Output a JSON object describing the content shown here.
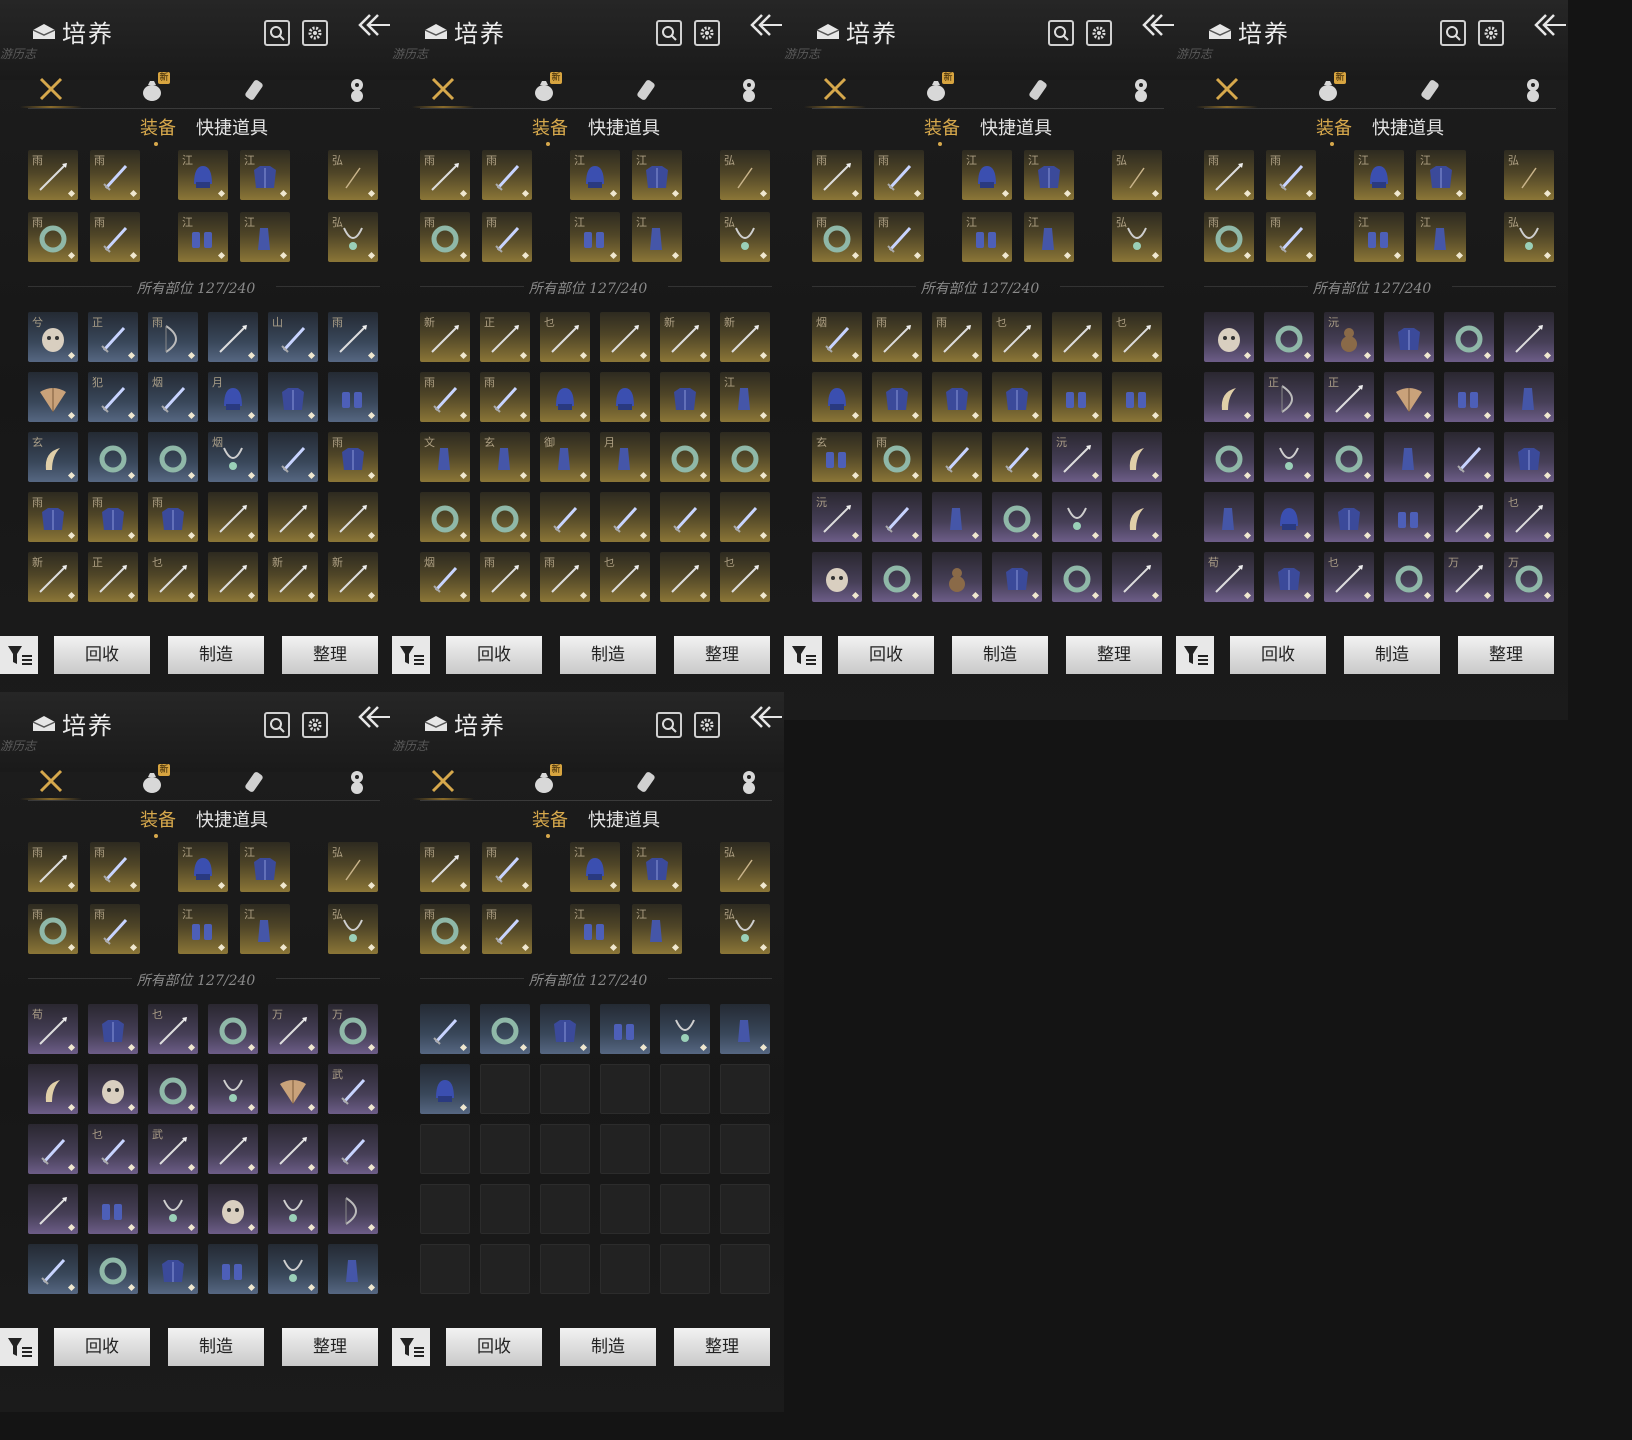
{
  "title": "培养",
  "subtitle": "游历志",
  "tab_new_badge": "新",
  "subtabs": {
    "equipment": "装备",
    "quick_items": "快捷道具"
  },
  "count_label": "所有部位 127/240",
  "footer": {
    "recycle": "回收",
    "craft": "制造",
    "organize": "整理"
  },
  "colors": {
    "accent": "#d6a84c",
    "gold": "#8b7637",
    "blue": "#566782",
    "purple": "#6d5d88"
  },
  "equipped": [
    {
      "ch": "雨",
      "icon": "spear-icon"
    },
    {
      "ch": "雨",
      "icon": "blade-icon"
    },
    {
      "ch": "江",
      "icon": "helmet-icon"
    },
    {
      "ch": "江",
      "icon": "armor-icon"
    },
    {
      "ch": "弘",
      "icon": "talisman-icon"
    },
    {
      "ch": "雨",
      "icon": "ring-icon"
    },
    {
      "ch": "雨",
      "icon": "blade-icon"
    },
    {
      "ch": "江",
      "icon": "gauntlet-icon"
    },
    {
      "ch": "江",
      "icon": "greave-icon"
    },
    {
      "ch": "弘",
      "icon": "necklace-icon"
    }
  ],
  "panels": [
    {
      "items": [
        {
          "r": "blue",
          "ch": "兮",
          "icon": "mask-icon"
        },
        {
          "r": "blue",
          "ch": "正",
          "icon": "blade-icon"
        },
        {
          "r": "blue",
          "ch": "雨",
          "icon": "bow-icon"
        },
        {
          "r": "blue",
          "ch": "",
          "icon": "spear-icon"
        },
        {
          "r": "blue",
          "ch": "山",
          "icon": "blade-icon"
        },
        {
          "r": "blue",
          "ch": "雨",
          "icon": "spear-icon"
        },
        {
          "r": "blue",
          "ch": "",
          "icon": "fan-icon"
        },
        {
          "r": "blue",
          "ch": "犯",
          "icon": "blade-icon"
        },
        {
          "r": "blue",
          "ch": "烟",
          "icon": "blade-icon"
        },
        {
          "r": "blue",
          "ch": "月",
          "icon": "helmet-icon"
        },
        {
          "r": "blue",
          "ch": "",
          "icon": "armor-icon"
        },
        {
          "r": "blue",
          "ch": "",
          "icon": "gauntlet-icon"
        },
        {
          "r": "blue",
          "ch": "玄",
          "icon": "horn-icon"
        },
        {
          "r": "blue",
          "ch": "",
          "icon": "ring-icon"
        },
        {
          "r": "blue",
          "ch": "",
          "icon": "ring-icon"
        },
        {
          "r": "blue",
          "ch": "烟",
          "icon": "necklace-icon"
        },
        {
          "r": "blue",
          "ch": "",
          "icon": "blade-icon"
        },
        {
          "r": "gold",
          "ch": "雨",
          "icon": "armor-icon"
        },
        {
          "r": "gold",
          "ch": "雨",
          "icon": "armor-icon"
        },
        {
          "r": "gold",
          "ch": "雨",
          "icon": "armor-icon"
        },
        {
          "r": "gold",
          "ch": "雨",
          "icon": "armor-icon"
        },
        {
          "r": "gold",
          "ch": "",
          "icon": "spear-icon"
        },
        {
          "r": "gold",
          "ch": "",
          "icon": "spear-icon"
        },
        {
          "r": "gold",
          "ch": "",
          "icon": "spear-icon"
        },
        {
          "r": "gold",
          "ch": "新",
          "icon": "spear-icon"
        },
        {
          "r": "gold",
          "ch": "正",
          "icon": "spear-icon"
        },
        {
          "r": "gold",
          "ch": "乜",
          "icon": "spear-icon"
        },
        {
          "r": "gold",
          "ch": "",
          "icon": "spear-icon"
        },
        {
          "r": "gold",
          "ch": "新",
          "icon": "spear-icon"
        },
        {
          "r": "gold",
          "ch": "新",
          "icon": "spear-icon"
        }
      ]
    },
    {
      "items": [
        {
          "r": "gold",
          "ch": "新",
          "icon": "spear-icon"
        },
        {
          "r": "gold",
          "ch": "正",
          "icon": "spear-icon"
        },
        {
          "r": "gold",
          "ch": "乜",
          "icon": "spear-icon"
        },
        {
          "r": "gold",
          "ch": "",
          "icon": "spear-icon"
        },
        {
          "r": "gold",
          "ch": "新",
          "icon": "spear-icon"
        },
        {
          "r": "gold",
          "ch": "新",
          "icon": "spear-icon"
        },
        {
          "r": "gold",
          "ch": "雨",
          "icon": "blade-icon"
        },
        {
          "r": "gold",
          "ch": "雨",
          "icon": "blade-icon"
        },
        {
          "r": "gold",
          "ch": "",
          "icon": "helmet-icon"
        },
        {
          "r": "gold",
          "ch": "",
          "icon": "helmet-icon"
        },
        {
          "r": "gold",
          "ch": "",
          "icon": "armor-icon"
        },
        {
          "r": "gold",
          "ch": "江",
          "icon": "greave-icon"
        },
        {
          "r": "gold",
          "ch": "文",
          "icon": "greave-icon"
        },
        {
          "r": "gold",
          "ch": "玄",
          "icon": "greave-icon"
        },
        {
          "r": "gold",
          "ch": "御",
          "icon": "greave-icon"
        },
        {
          "r": "gold",
          "ch": "月",
          "icon": "greave-icon"
        },
        {
          "r": "gold",
          "ch": "",
          "icon": "ring-icon"
        },
        {
          "r": "gold",
          "ch": "",
          "icon": "ring-icon"
        },
        {
          "r": "gold",
          "ch": "",
          "icon": "ring-icon"
        },
        {
          "r": "gold",
          "ch": "",
          "icon": "ring-icon"
        },
        {
          "r": "gold",
          "ch": "",
          "icon": "blade-icon"
        },
        {
          "r": "gold",
          "ch": "",
          "icon": "blade-icon"
        },
        {
          "r": "gold",
          "ch": "",
          "icon": "blade-icon"
        },
        {
          "r": "gold",
          "ch": "",
          "icon": "blade-icon"
        },
        {
          "r": "gold",
          "ch": "烟",
          "icon": "blade-icon"
        },
        {
          "r": "gold",
          "ch": "雨",
          "icon": "spear-icon"
        },
        {
          "r": "gold",
          "ch": "雨",
          "icon": "spear-icon"
        },
        {
          "r": "gold",
          "ch": "乜",
          "icon": "spear-icon"
        },
        {
          "r": "gold",
          "ch": "",
          "icon": "spear-icon"
        },
        {
          "r": "gold",
          "ch": "乜",
          "icon": "spear-icon"
        }
      ]
    },
    {
      "items": [
        {
          "r": "gold",
          "ch": "烟",
          "icon": "blade-icon"
        },
        {
          "r": "gold",
          "ch": "雨",
          "icon": "spear-icon"
        },
        {
          "r": "gold",
          "ch": "雨",
          "icon": "spear-icon"
        },
        {
          "r": "gold",
          "ch": "乜",
          "icon": "spear-icon"
        },
        {
          "r": "gold",
          "ch": "",
          "icon": "spear-icon"
        },
        {
          "r": "gold",
          "ch": "乜",
          "icon": "spear-icon"
        },
        {
          "r": "gold",
          "ch": "",
          "icon": "helmet-icon"
        },
        {
          "r": "gold",
          "ch": "",
          "icon": "armor-icon"
        },
        {
          "r": "gold",
          "ch": "",
          "icon": "armor-icon"
        },
        {
          "r": "gold",
          "ch": "",
          "icon": "armor-icon"
        },
        {
          "r": "gold",
          "ch": "",
          "icon": "gauntlet-icon"
        },
        {
          "r": "gold",
          "ch": "",
          "icon": "gauntlet-icon"
        },
        {
          "r": "gold",
          "ch": "玄",
          "icon": "gauntlet-icon"
        },
        {
          "r": "gold",
          "ch": "雨",
          "icon": "ring-icon"
        },
        {
          "r": "gold",
          "ch": "",
          "icon": "blade-icon"
        },
        {
          "r": "gold",
          "ch": "",
          "icon": "blade-icon"
        },
        {
          "r": "purple",
          "ch": "沅",
          "icon": "spear-icon"
        },
        {
          "r": "purple",
          "ch": "",
          "icon": "horn-icon"
        },
        {
          "r": "purple",
          "ch": "沅",
          "icon": "spear-icon"
        },
        {
          "r": "purple",
          "ch": "",
          "icon": "blade-icon"
        },
        {
          "r": "purple",
          "ch": "",
          "icon": "greave-icon"
        },
        {
          "r": "purple",
          "ch": "",
          "icon": "ring-icon"
        },
        {
          "r": "purple",
          "ch": "",
          "icon": "necklace-icon"
        },
        {
          "r": "purple",
          "ch": "",
          "icon": "horn-icon"
        },
        {
          "r": "purple",
          "ch": "",
          "icon": "mask-icon"
        },
        {
          "r": "purple",
          "ch": "",
          "icon": "ring-icon"
        },
        {
          "r": "purple",
          "ch": "",
          "icon": "gourd-icon"
        },
        {
          "r": "purple",
          "ch": "",
          "icon": "armor-icon"
        },
        {
          "r": "purple",
          "ch": "",
          "icon": "ring-icon"
        },
        {
          "r": "purple",
          "ch": "",
          "icon": "spear-icon"
        }
      ]
    },
    {
      "items": [
        {
          "r": "purple",
          "ch": "",
          "icon": "mask-icon"
        },
        {
          "r": "purple",
          "ch": "",
          "icon": "ring-icon"
        },
        {
          "r": "purple",
          "ch": "沅",
          "icon": "gourd-icon"
        },
        {
          "r": "purple",
          "ch": "",
          "icon": "armor-icon"
        },
        {
          "r": "purple",
          "ch": "",
          "icon": "ring-icon"
        },
        {
          "r": "purple",
          "ch": "",
          "icon": "spear-icon"
        },
        {
          "r": "purple",
          "ch": "",
          "icon": "horn-icon"
        },
        {
          "r": "purple",
          "ch": "正",
          "icon": "bow-icon"
        },
        {
          "r": "purple",
          "ch": "正",
          "icon": "spear-icon"
        },
        {
          "r": "purple",
          "ch": "",
          "icon": "fan-icon"
        },
        {
          "r": "purple",
          "ch": "",
          "icon": "gauntlet-icon"
        },
        {
          "r": "purple",
          "ch": "",
          "icon": "greave-icon"
        },
        {
          "r": "purple",
          "ch": "",
          "icon": "ring-icon"
        },
        {
          "r": "purple",
          "ch": "",
          "icon": "necklace-icon"
        },
        {
          "r": "purple",
          "ch": "",
          "icon": "ring-icon"
        },
        {
          "r": "purple",
          "ch": "",
          "icon": "greave-icon"
        },
        {
          "r": "purple",
          "ch": "",
          "icon": "blade-icon"
        },
        {
          "r": "purple",
          "ch": "",
          "icon": "armor-icon"
        },
        {
          "r": "purple",
          "ch": "",
          "icon": "greave-icon"
        },
        {
          "r": "purple",
          "ch": "",
          "icon": "helmet-icon"
        },
        {
          "r": "purple",
          "ch": "",
          "icon": "armor-icon"
        },
        {
          "r": "purple",
          "ch": "",
          "icon": "gauntlet-icon"
        },
        {
          "r": "purple",
          "ch": "",
          "icon": "spear-icon"
        },
        {
          "r": "purple",
          "ch": "乜",
          "icon": "spear-icon"
        },
        {
          "r": "purple",
          "ch": "荀",
          "icon": "spear-icon"
        },
        {
          "r": "purple",
          "ch": "",
          "icon": "armor-icon"
        },
        {
          "r": "purple",
          "ch": "乜",
          "icon": "spear-icon"
        },
        {
          "r": "purple",
          "ch": "",
          "icon": "ring-icon"
        },
        {
          "r": "purple",
          "ch": "万",
          "icon": "spear-icon"
        },
        {
          "r": "purple",
          "ch": "万",
          "icon": "ring-icon"
        }
      ]
    },
    {
      "items": [
        {
          "r": "purple",
          "ch": "荀",
          "icon": "spear-icon"
        },
        {
          "r": "purple",
          "ch": "",
          "icon": "armor-icon"
        },
        {
          "r": "purple",
          "ch": "乜",
          "icon": "spear-icon"
        },
        {
          "r": "purple",
          "ch": "",
          "icon": "ring-icon"
        },
        {
          "r": "purple",
          "ch": "万",
          "icon": "spear-icon"
        },
        {
          "r": "purple",
          "ch": "万",
          "icon": "ring-icon"
        },
        {
          "r": "purple",
          "ch": "",
          "icon": "horn-icon"
        },
        {
          "r": "purple",
          "ch": "",
          "icon": "mask-icon"
        },
        {
          "r": "purple",
          "ch": "",
          "icon": "ring-icon"
        },
        {
          "r": "purple",
          "ch": "",
          "icon": "necklace-icon"
        },
        {
          "r": "purple",
          "ch": "",
          "icon": "fan-icon"
        },
        {
          "r": "purple",
          "ch": "武",
          "icon": "blade-icon"
        },
        {
          "r": "purple",
          "ch": "",
          "icon": "blade-icon"
        },
        {
          "r": "purple",
          "ch": "乜",
          "icon": "blade-icon"
        },
        {
          "r": "purple",
          "ch": "武",
          "icon": "spear-icon"
        },
        {
          "r": "purple",
          "ch": "",
          "icon": "spear-icon"
        },
        {
          "r": "purple",
          "ch": "",
          "icon": "spear-icon"
        },
        {
          "r": "purple",
          "ch": "",
          "icon": "blade-icon"
        },
        {
          "r": "purple",
          "ch": "",
          "icon": "spear-icon"
        },
        {
          "r": "purple",
          "ch": "",
          "icon": "gauntlet-icon"
        },
        {
          "r": "purple",
          "ch": "",
          "icon": "necklace-icon"
        },
        {
          "r": "purple",
          "ch": "",
          "icon": "mask-icon"
        },
        {
          "r": "purple",
          "ch": "",
          "icon": "necklace-icon"
        },
        {
          "r": "purple",
          "ch": "",
          "icon": "bow-icon"
        },
        {
          "r": "blue",
          "ch": "",
          "icon": "blade-icon"
        },
        {
          "r": "blue",
          "ch": "",
          "icon": "ring-icon"
        },
        {
          "r": "blue",
          "ch": "",
          "icon": "armor-icon"
        },
        {
          "r": "blue",
          "ch": "",
          "icon": "gauntlet-icon"
        },
        {
          "r": "blue",
          "ch": "",
          "icon": "necklace-icon"
        },
        {
          "r": "blue",
          "ch": "",
          "icon": "greave-icon"
        }
      ]
    },
    {
      "items": [
        {
          "r": "blue",
          "ch": "",
          "icon": "blade-icon"
        },
        {
          "r": "blue",
          "ch": "",
          "icon": "ring-icon"
        },
        {
          "r": "blue",
          "ch": "",
          "icon": "armor-icon"
        },
        {
          "r": "blue",
          "ch": "",
          "icon": "gauntlet-icon"
        },
        {
          "r": "blue",
          "ch": "",
          "icon": "necklace-icon"
        },
        {
          "r": "blue",
          "ch": "",
          "icon": "greave-icon"
        },
        {
          "r": "blue",
          "ch": "",
          "icon": "helmet-icon"
        },
        {
          "r": "empty"
        },
        {
          "r": "empty"
        },
        {
          "r": "empty"
        },
        {
          "r": "empty"
        },
        {
          "r": "empty"
        },
        {
          "r": "empty"
        },
        {
          "r": "empty"
        },
        {
          "r": "empty"
        },
        {
          "r": "empty"
        },
        {
          "r": "empty"
        },
        {
          "r": "empty"
        },
        {
          "r": "empty"
        },
        {
          "r": "empty"
        },
        {
          "r": "empty"
        },
        {
          "r": "empty"
        },
        {
          "r": "empty"
        },
        {
          "r": "empty"
        },
        {
          "r": "empty"
        },
        {
          "r": "empty"
        },
        {
          "r": "empty"
        },
        {
          "r": "empty"
        },
        {
          "r": "empty"
        },
        {
          "r": "empty"
        }
      ]
    }
  ]
}
